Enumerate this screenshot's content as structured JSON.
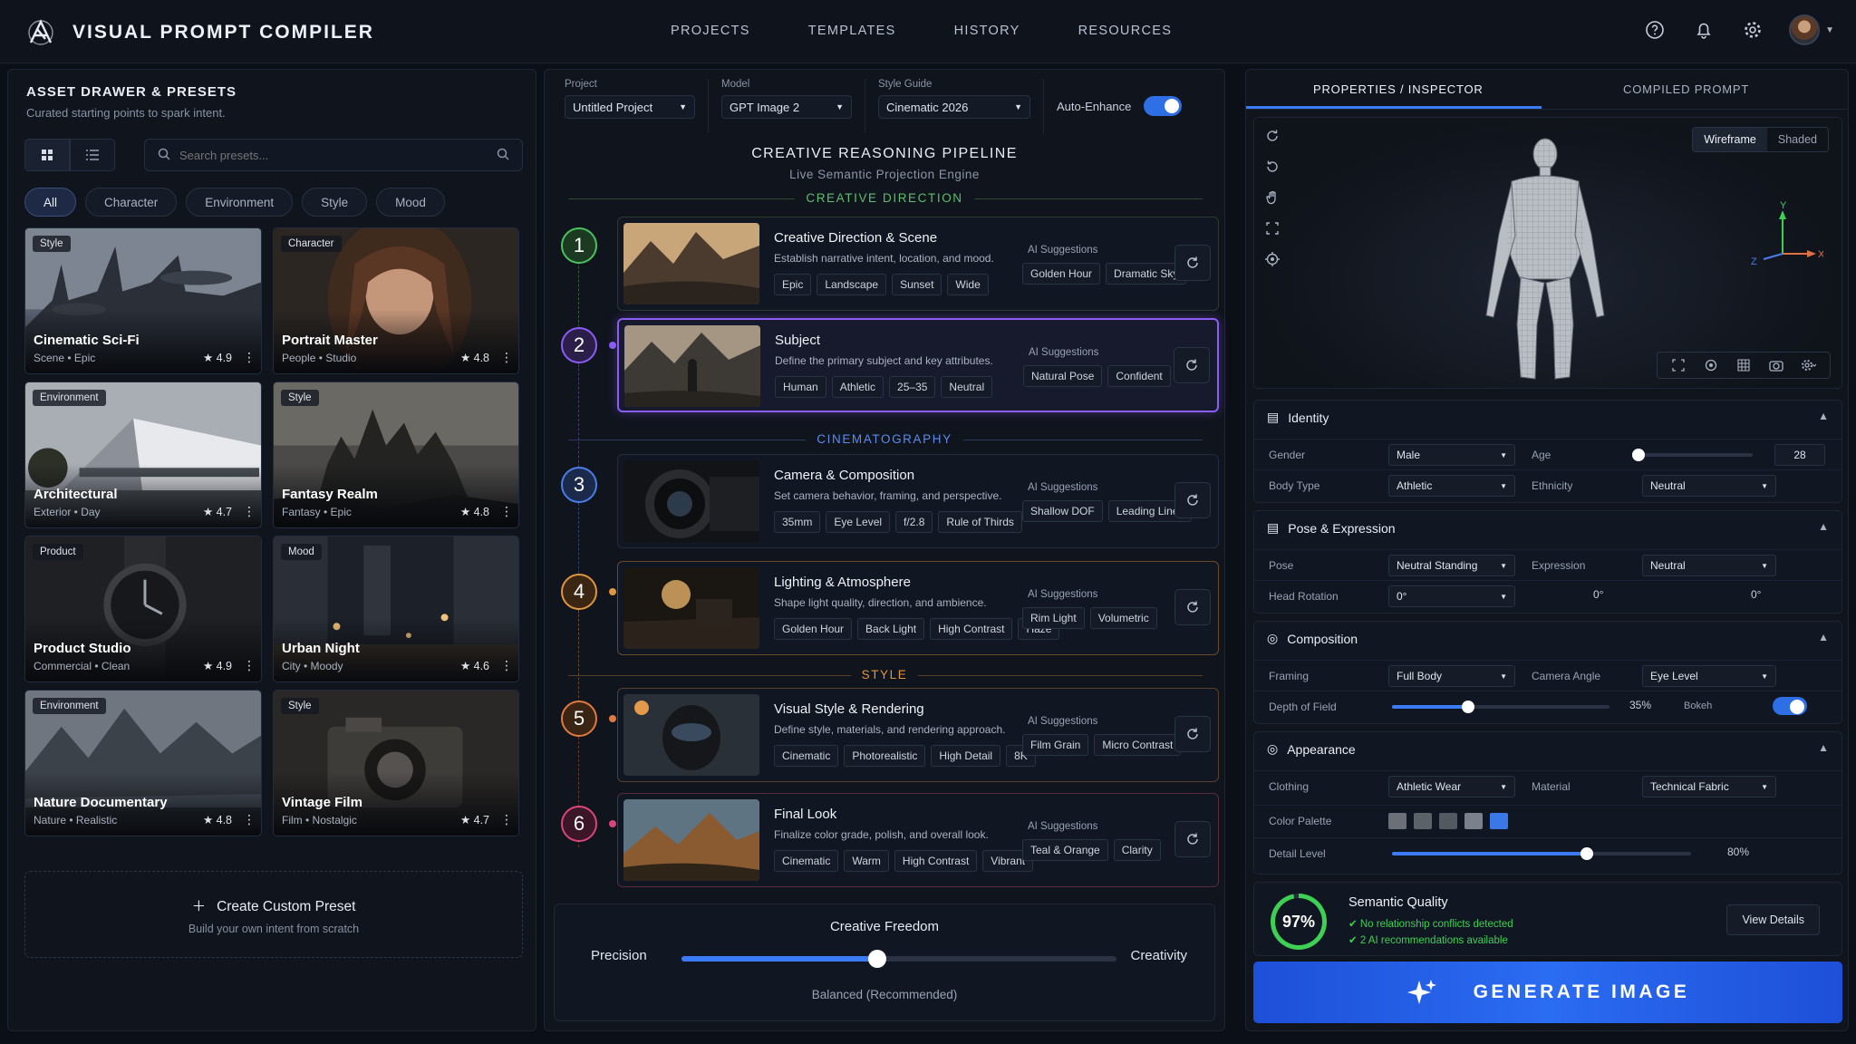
{
  "app": {
    "title": "VISUAL PROMPT COMPILER"
  },
  "nav": [
    "PROJECTS",
    "TEMPLATES",
    "HISTORY",
    "RESOURCES"
  ],
  "drawer": {
    "title": "ASSET DRAWER & PRESETS",
    "subtitle": "Curated starting points to spark intent.",
    "search_placeholder": "Search presets...",
    "filters": [
      "All",
      "Character",
      "Environment",
      "Style",
      "Mood"
    ],
    "presets": [
      {
        "tag": "Style",
        "name": "Cinematic Sci-Fi",
        "meta": "Scene • Epic",
        "rating": "★ 4.9"
      },
      {
        "tag": "Character",
        "name": "Portrait Master",
        "meta": "People • Studio",
        "rating": "★ 4.8"
      },
      {
        "tag": "Environment",
        "name": "Architectural",
        "meta": "Exterior • Day",
        "rating": "★ 4.7"
      },
      {
        "tag": "Style",
        "name": "Fantasy Realm",
        "meta": "Fantasy • Epic",
        "rating": "★ 4.8"
      },
      {
        "tag": "Product",
        "name": "Product Studio",
        "meta": "Commercial • Clean",
        "rating": "★ 4.9"
      },
      {
        "tag": "Mood",
        "name": "Urban Night",
        "meta": "City • Moody",
        "rating": "★ 4.6"
      },
      {
        "tag": "Environment",
        "name": "Nature Documentary",
        "meta": "Nature • Realistic",
        "rating": "★ 4.8"
      },
      {
        "tag": "Style",
        "name": "Vintage Film",
        "meta": "Film • Nostalgic",
        "rating": "★ 4.7"
      }
    ],
    "custom_title": "Create Custom Preset",
    "custom_sub": "Build your own intent from scratch"
  },
  "settings": {
    "project_label": "Project",
    "project_value": "Untitled Project",
    "model_label": "Model",
    "model_value": "GPT Image 2",
    "style_label": "Style Guide",
    "style_value": "Cinematic 2026",
    "auto_label": "Auto-Enhance",
    "auto_on": true
  },
  "pipeline": {
    "title": "CREATIVE REASONING PIPELINE",
    "subtitle": "Live Semantic Projection Engine",
    "sections": [
      "CREATIVE DIRECTION",
      "CINEMATOGRAPHY",
      "STYLE"
    ],
    "ai_label": "AI Suggestions",
    "stages": [
      {
        "n": "1",
        "title": "Creative Direction & Scene",
        "desc": "Establish narrative intent, location, and mood.",
        "chips": [
          "Epic",
          "Landscape",
          "Sunset",
          "Wide"
        ],
        "ai": [
          "Golden Hour",
          "Dramatic Sky"
        ]
      },
      {
        "n": "2",
        "title": "Subject",
        "desc": "Define the primary subject and key attributes.",
        "chips": [
          "Human",
          "Athletic",
          "25–35",
          "Neutral"
        ],
        "ai": [
          "Natural Pose",
          "Confident"
        ]
      },
      {
        "n": "3",
        "title": "Camera & Composition",
        "desc": "Set camera behavior, framing, and perspective.",
        "chips": [
          "35mm",
          "Eye Level",
          "f/2.8",
          "Rule of Thirds"
        ],
        "ai": [
          "Shallow DOF",
          "Leading Lines"
        ]
      },
      {
        "n": "4",
        "title": "Lighting & Atmosphere",
        "desc": "Shape light quality, direction, and ambience.",
        "chips": [
          "Golden Hour",
          "Back Light",
          "High Contrast",
          "Haze"
        ],
        "ai": [
          "Rim Light",
          "Volumetric"
        ]
      },
      {
        "n": "5",
        "title": "Visual Style & Rendering",
        "desc": "Define style, materials, and rendering approach.",
        "chips": [
          "Cinematic",
          "Photorealistic",
          "High Detail",
          "8K"
        ],
        "ai": [
          "Film Grain",
          "Micro Contrast"
        ]
      },
      {
        "n": "6",
        "title": "Final Look",
        "desc": "Finalize color grade, polish, and overall look.",
        "chips": [
          "Cinematic",
          "Warm",
          "High Contrast",
          "Vibrant"
        ],
        "ai": [
          "Teal & Orange",
          "Clarity"
        ]
      }
    ]
  },
  "freedom": {
    "title": "Creative Freedom",
    "left": "Precision",
    "right": "Creativity",
    "note": "Balanced (Recommended)",
    "value": 0.45
  },
  "inspector": {
    "tabs": [
      "PROPERTIES / INSPECTOR",
      "COMPILED PROMPT"
    ],
    "view_modes": [
      "Wireframe",
      "Shaded"
    ],
    "axes": {
      "y": "Y",
      "z": "Z",
      "x": "X"
    },
    "identity": {
      "title": "Identity",
      "gender_l": "Gender",
      "gender": "Male",
      "age_l": "Age",
      "age": "28",
      "age_frac": 0.0,
      "body_l": "Body Type",
      "body": "Athletic",
      "eth_l": "Ethnicity",
      "eth": "Neutral"
    },
    "pose": {
      "title": "Pose & Expression",
      "pose_l": "Pose",
      "pose": "Neutral Standing",
      "expr_l": "Expression",
      "expr": "Neutral",
      "head_l": "Head Rotation",
      "head1": "0°",
      "head2": "0°",
      "head3": "0°"
    },
    "composition": {
      "title": "Composition",
      "framing_l": "Framing",
      "framing": "Full Body",
      "angle_l": "Camera Angle",
      "angle": "Eye Level",
      "dof_l": "Depth of Field",
      "dof": "35%",
      "dof_frac": 0.35,
      "bokeh_l": "Bokeh"
    },
    "appearance": {
      "title": "Appearance",
      "cloth_l": "Clothing",
      "cloth": "Athletic Wear",
      "mat_l": "Material",
      "mat": "Technical Fabric",
      "palette_l": "Color Palette",
      "palette": [
        "#6b6f77",
        "#5d6168",
        "#545860",
        "#7a808c",
        "#3a78e8"
      ],
      "detail_l": "Detail Level",
      "detail": "80%",
      "detail_frac": 0.65
    },
    "quality": {
      "score": "97%",
      "title": "Semantic Quality",
      "line1": "No relationship conflicts detected",
      "line2": "2 AI recommendations available",
      "button": "View Details"
    },
    "generate": "GENERATE IMAGE"
  }
}
